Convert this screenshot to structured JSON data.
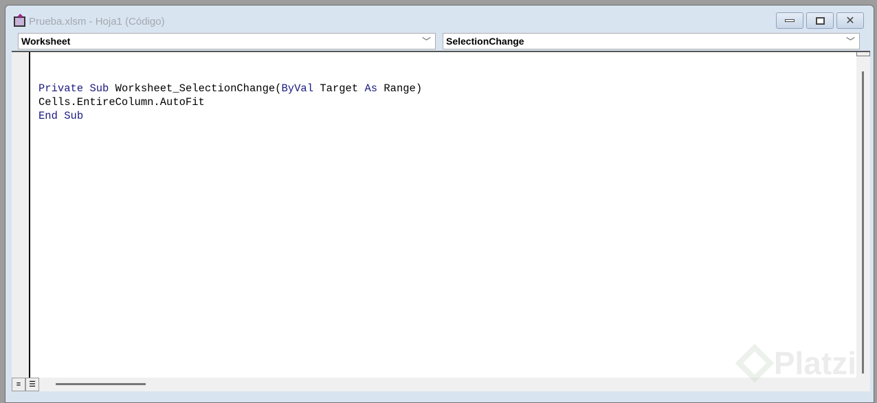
{
  "window": {
    "title": "Prueba.xlsm - Hoja1 (Código)"
  },
  "object_dropdown": {
    "value": "Worksheet"
  },
  "procedure_dropdown": {
    "value": "SelectionChange"
  },
  "code": {
    "line1": {
      "k1": "Private",
      "k2": "Sub",
      "t1": " Worksheet_SelectionChange(",
      "k3": "ByVal",
      "t2": " Target ",
      "k4": "As",
      "t3": " Range)"
    },
    "line2": "Cells.EntireColumn.AutoFit",
    "line3": {
      "k1": "End",
      "k2": "Sub"
    }
  },
  "watermark": "Platzi",
  "colors": {
    "keyword": "#1a1a80"
  }
}
